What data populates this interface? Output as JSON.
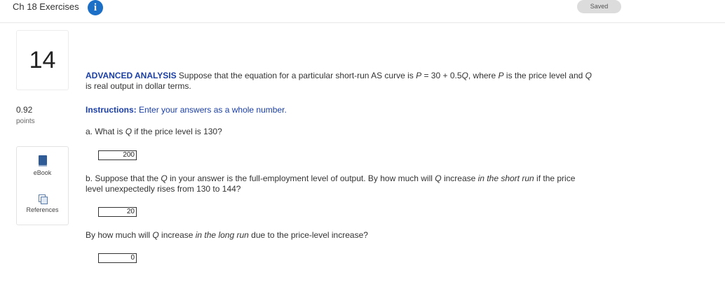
{
  "header": {
    "title": "Ch 18 Exercises",
    "info_icon": "i",
    "saved_label": "Saved"
  },
  "sidebar": {
    "question_number": "14",
    "score": "0.92",
    "score_unit": "points",
    "tools": [
      {
        "label": "eBook",
        "icon": "book-icon"
      },
      {
        "label": "References",
        "icon": "documents-icon"
      }
    ]
  },
  "question": {
    "heading": "ADVANCED ANALYSIS",
    "intro_1": " Suppose that the equation for a particular short-run AS curve is ",
    "var_p": "P",
    "intro_2": " = 30 + 0.5",
    "var_q": "Q",
    "intro_3": ", where ",
    "intro_4": " is the price level and ",
    "intro_5": "is real output in dollar terms.",
    "instructions_label": "Instructions:",
    "instructions_text": " Enter your answers as a whole number.",
    "part_a_1": "a. What is ",
    "part_a_2": " if the price level is 130?",
    "answer_a": "200",
    "part_b_1": "b. Suppose that the ",
    "part_b_2": " in your answer is the full-employment level of output. By how much will ",
    "part_b_3": " increase ",
    "part_b_em": "in the short run",
    "part_b_4": " if the price",
    "part_b_5": "level unexpectedly rises from 130 to 144?",
    "answer_b": "20",
    "part_c_1": "By how much will ",
    "part_c_2": " increase ",
    "part_c_em": "in the long run",
    "part_c_3": " due to the price-level increase?",
    "answer_c": "0"
  }
}
